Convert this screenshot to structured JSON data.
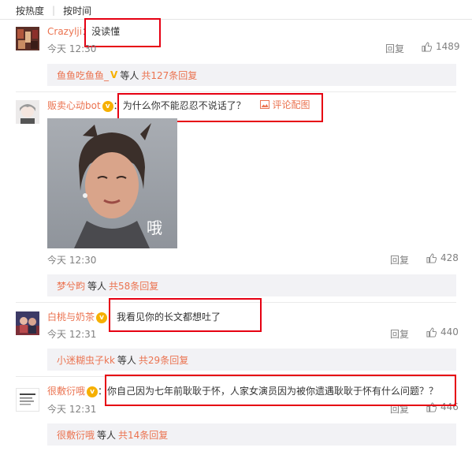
{
  "tabs": {
    "hot": "按热度",
    "time": "按时间"
  },
  "comments": [
    {
      "user": "Crazylji",
      "text": "没读懂",
      "time": "今天 12:30",
      "reply_label": "回复",
      "likes": "1489",
      "sub": {
        "user": "鱼鱼吃鱼鱼_",
        "middle": "等人",
        "count_link": "共127条回复"
      }
    },
    {
      "user": "贩卖心动bot",
      "text": "为什么你不能忍忍不说话了？",
      "pic_link": "评论配图",
      "image_caption": "哦",
      "time": "今天 12:30",
      "reply_label": "回复",
      "likes": "428",
      "sub": {
        "user": "梦兮畇",
        "middle": "等人",
        "count_link": "共58条回复"
      }
    },
    {
      "user": "白桃与奶茶",
      "text": "我看见你的长文都想吐了",
      "time": "今天 12:31",
      "reply_label": "回复",
      "likes": "440",
      "sub": {
        "user": "小迷糊虫子kk",
        "middle": "等人",
        "count_link": "共29条回复"
      }
    },
    {
      "user": "很敷衍哦",
      "text": "你自己因为七年前耿耿于怀，人家女演员因为被你遗遇耿耿于怀有什么问题？？",
      "time": "今天 12:31",
      "reply_label": "回复",
      "likes": "446",
      "sub": {
        "user": "很敷衍哦",
        "middle": "等人",
        "count_link": "共14条回复"
      }
    }
  ],
  "colors": {
    "username": "#eb7350",
    "highlight": "#e60012",
    "subbox": "#f2f2f5",
    "badge": "#f6b000"
  }
}
